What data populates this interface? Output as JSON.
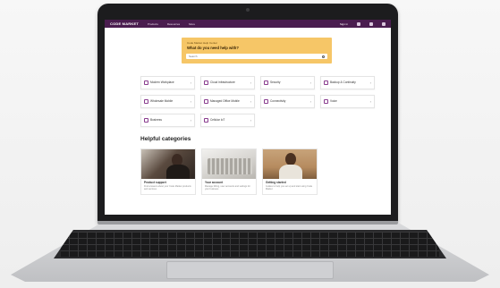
{
  "nav": {
    "brand": "CODE MARKET",
    "links": [
      "Products",
      "Resources",
      "More"
    ],
    "signin": "Sign in"
  },
  "hero": {
    "kicker": "Code Market Help Center",
    "question": "What do you need help with?",
    "search_placeholder": "Search"
  },
  "tiles": [
    "Modern Workplace",
    "Cloud infrastructure",
    "Security",
    "Backup & Continuity",
    "Wholesale Mobile",
    "Managed Office Mobile",
    "Connectivity",
    "Voice",
    "Business",
    "Cellular IoT"
  ],
  "categories": {
    "title": "Helpful categories",
    "cards": [
      {
        "title": "Product support",
        "desc": "Find answers about your Code Market products and services"
      },
      {
        "title": "Your account",
        "desc": "Manage billing, user accounts and settings for your business"
      },
      {
        "title": "Getting started",
        "desc": "Guides to help you set up and start using Code Market"
      }
    ]
  },
  "colors": {
    "nav_bg": "#4a1d4f",
    "hero_bg": "#f6c667",
    "accent": "#8a3d8f"
  }
}
